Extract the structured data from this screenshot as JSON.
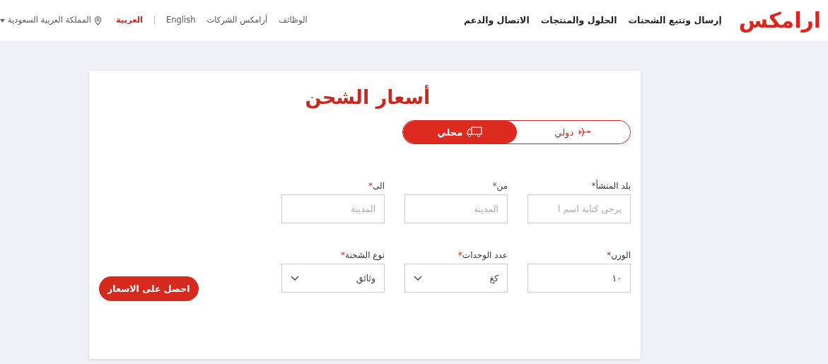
{
  "header": {
    "logo": "ارامكس",
    "nav": [
      "إرسال وتتبع الشحنات",
      "الحلول والمنتجات",
      "الاتصال والدعم"
    ],
    "top_links": [
      "الوظائف",
      "أرامكس الشركات"
    ],
    "languages": [
      {
        "label": "English",
        "selected": false
      },
      {
        "label": "العربية",
        "selected": true
      }
    ],
    "country": "المملكة العربية السعودية"
  },
  "form": {
    "title": "أسعار الشحن",
    "tabs": [
      {
        "label": "دولي",
        "kind": "plane",
        "selected": false
      },
      {
        "label": "محلي",
        "kind": "truck",
        "selected": true
      }
    ],
    "required_mark": "*",
    "rows": [
      [
        {
          "kind": "input",
          "label": "بلد المنشأ",
          "required": true,
          "placeholder": "يرجى كتابة اسم ا"
        },
        {
          "kind": "input",
          "label": "من",
          "required": true,
          "placeholder": "المدينة"
        },
        {
          "kind": "input",
          "label": "الى",
          "required": true,
          "placeholder": "المدينة"
        }
      ],
      [
        {
          "kind": "input",
          "label": "الوزن",
          "required": true,
          "value": "١٠"
        },
        {
          "kind": "select",
          "label": "عدد الوحدات",
          "required": true,
          "value": "كغ"
        },
        {
          "kind": "select",
          "label": "نوع الشحنة",
          "required": true,
          "value": "وثائق"
        }
      ]
    ],
    "submit": "احصل على الاسعار"
  }
}
